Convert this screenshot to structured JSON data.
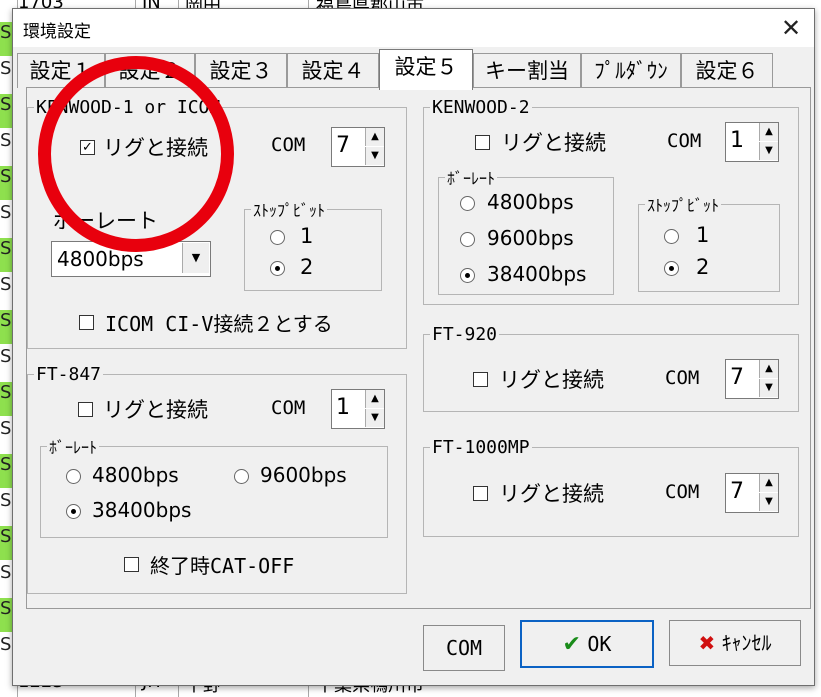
{
  "background": {
    "top_row": {
      "id": "1703",
      "col2": "JN",
      "col3": "岡田",
      "col4": "福島県郡山市"
    },
    "bottom_row": {
      "id": "1223",
      "col2": "JH",
      "col3": "平野",
      "col4": "千葉県鴨川市"
    },
    "left_cells": [
      "SB",
      "SB",
      "SB",
      "SB",
      "SB",
      "SB",
      "SB",
      "SB",
      "SB",
      "SB",
      "SB",
      "SB",
      "SB",
      "SB",
      "SB",
      "SB",
      "SB",
      "SB",
      "SB"
    ]
  },
  "dialog": {
    "title": "環境設定",
    "close_symbol": "✕",
    "tabs": [
      {
        "label": "設定１",
        "active": false
      },
      {
        "label": "設定２",
        "active": false
      },
      {
        "label": "設定３",
        "active": false
      },
      {
        "label": "設定４",
        "active": false
      },
      {
        "label": "設定５",
        "active": true
      },
      {
        "label": "キー割当",
        "active": false
      },
      {
        "label": "ﾌﾟﾙﾀﾞｳﾝ",
        "active": false
      },
      {
        "label": "設定６",
        "active": false
      }
    ]
  },
  "kenwood1": {
    "legend": "KENWOOD-1 or ICOM",
    "connect_label": "リグと接続",
    "connect_checked": true,
    "com_label": "COM",
    "com_value": "7",
    "baud_label": "ボーレート",
    "baud_value": "4800bps",
    "stopbit_legend": "ｽﾄｯﾌﾟﾋﾞｯﾄ",
    "stopbit_options": [
      "1",
      "2"
    ],
    "stopbit_selected": "2",
    "civ_label": "ICOM CI-V接続２とする",
    "civ_checked": false
  },
  "kenwood2": {
    "legend": "KENWOOD-2",
    "connect_label": "リグと接続",
    "connect_checked": false,
    "com_label": "COM",
    "com_value": "1",
    "baud_legend": "ﾎﾞｰﾚｰﾄ",
    "baud_options": [
      "4800bps",
      "9600bps",
      "38400bps"
    ],
    "baud_selected": "38400bps",
    "stopbit_legend": "ｽﾄｯﾌﾟﾋﾞｯﾄ",
    "stopbit_options": [
      "1",
      "2"
    ],
    "stopbit_selected": "2"
  },
  "ft847": {
    "legend": "FT-847",
    "connect_label": "リグと接続",
    "connect_checked": false,
    "com_label": "COM",
    "com_value": "1",
    "baud_legend": "ﾎﾞｰﾚｰﾄ",
    "baud_options": [
      "4800bps",
      "9600bps",
      "38400bps"
    ],
    "baud_selected": "38400bps",
    "cat_off_label": "終了時CAT-OFF",
    "cat_off_checked": false
  },
  "ft920": {
    "legend": "FT-920",
    "connect_label": "リグと接続",
    "connect_checked": false,
    "com_label": "COM",
    "com_value": "7"
  },
  "ft1000mp": {
    "legend": "FT-1000MP",
    "connect_label": "リグと接続",
    "connect_checked": false,
    "com_label": "COM",
    "com_value": "7"
  },
  "buttons": {
    "com_label": "COM",
    "ok_label": "OK",
    "cancel_label": "ｷｬﾝｾﾙ",
    "ok_icon_glyph": "✔",
    "cancel_icon_glyph": "✖"
  },
  "annotation": {
    "color": "#e8000d"
  },
  "colors": {
    "green_row": "#8ee04e",
    "ok_check": "#1a8c1a",
    "cancel_x": "#d01010",
    "default_button_border": "#0b62c4"
  }
}
